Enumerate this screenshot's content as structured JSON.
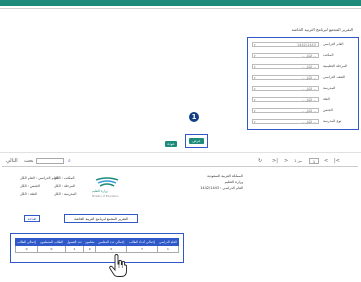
{
  "top_title": "",
  "page_title": "التقرير المجمع لبرنامج التربية الخاصة",
  "filters": [
    {
      "label": "العام الدراسي",
      "value": "1442/1443"
    },
    {
      "label": "المكتب",
      "value": "-- الكل --"
    },
    {
      "label": "المرحلة التعليمية",
      "value": "-- الكل --"
    },
    {
      "label": "الصف الدراسي",
      "value": "-- الكل --"
    },
    {
      "label": "المدرسة",
      "value": "-- الكل --"
    },
    {
      "label": "الفئة",
      "value": "-- الكل --"
    },
    {
      "label": "الجنس",
      "value": "-- الكل --"
    },
    {
      "label": "نوع المدرسة",
      "value": "-- الكل --"
    }
  ],
  "step_badge": "1",
  "buttons": {
    "view": "عرض",
    "back": "عودة",
    "print": "طباعة"
  },
  "toolbar": {
    "page_current": "1",
    "page_of": "من 1",
    "nav_first": "|<",
    "nav_prev": "<",
    "nav_next": ">",
    "nav_last": ">|",
    "refresh": "↻",
    "zoom": "100%",
    "find_label": "بحث",
    "next_label": "التالي"
  },
  "report_header": {
    "kingdom": "المملكة العربية السعودية",
    "ministry": "وزارة التعليم",
    "year": "العام الدراسي : 1442/1443",
    "logo_caption": "وزارة التعليم",
    "logo_sub": "Ministry of Education",
    "school_year_label": "العام الدراسي : العام الكل",
    "office_label": "المكتب : الكل",
    "stage_label": "المرحلة : الكل",
    "region_label": "المنطقة : الكل",
    "type_label": "نوع المدرسة : الكل",
    "gender_label": "الجنس : الكل",
    "category_label": "الفئة : الكل",
    "school_label": "المدرسة : الكل"
  },
  "report_title": "التقرير المجمع لبرنامج التربية الخاصة",
  "table": {
    "headers": [
      "العام الدراسي",
      "إجمالي أعداد الطلاب",
      "إجمالي عدد المعلمين",
      "معلمون",
      "عدد الفصول",
      "الطلاب المنتظمون",
      "إجمالي الطلاب"
    ],
    "row": [
      "1",
      "7",
      "0",
      "0",
      "1",
      "0",
      "0"
    ]
  }
}
